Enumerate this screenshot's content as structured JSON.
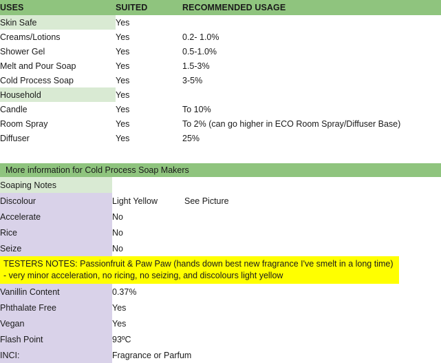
{
  "uses_table": {
    "headers": {
      "uses": "USES",
      "suited": "SUITED",
      "usage": "RECOMMENDED USAGE"
    },
    "sections": [
      {
        "title": "Skin Safe",
        "title_suited": "Yes",
        "rows": [
          {
            "label": "Creams/Lotions",
            "suited": "Yes",
            "usage": "0.2- 1.0%"
          },
          {
            "label": "Shower Gel",
            "suited": "Yes",
            "usage": "0.5-1.0%"
          },
          {
            "label": "Melt and Pour Soap",
            "suited": "Yes",
            "usage": "1.5-3%"
          },
          {
            "label": "Cold Process Soap",
            "suited": "Yes",
            "usage": "3-5%"
          }
        ]
      },
      {
        "title": "Household",
        "title_suited": "Yes",
        "rows": [
          {
            "label": "Candle",
            "suited": "Yes",
            "usage": "To 10%"
          },
          {
            "label": "Room Spray",
            "suited": "Yes",
            "usage": "To 2% (can go higher in ECO Room Spray/Diffuser Base)"
          },
          {
            "label": "Diffuser",
            "suited": "Yes",
            "usage": "25%"
          }
        ]
      }
    ]
  },
  "cp_section": {
    "banner": "More information for Cold Process Soap Makers",
    "notes_header": "Soaping Notes",
    "notes": [
      {
        "label": "Discolour",
        "value": "Light Yellow",
        "extra": "See Picture"
      },
      {
        "label": "Accelerate",
        "value": "No",
        "extra": ""
      },
      {
        "label": "Rice",
        "value": "No",
        "extra": ""
      },
      {
        "label": "Seize",
        "value": "No",
        "extra": ""
      }
    ],
    "testers_notes": "TESTERS NOTES: Passionfruit & Paw Paw (hands down best new fragrance I've smelt in a long time) - very minor acceleration, no ricing, no seizing, and discolours light yellow",
    "specs": [
      {
        "label": "Vanillin Content",
        "value": "0.37%"
      },
      {
        "label": "Phthalate Free",
        "value": "Yes"
      },
      {
        "label": "Vegan",
        "value": "Yes"
      },
      {
        "label": "Flash Point",
        "value": "93ºC"
      },
      {
        "label": "INCI:",
        "value": "Fragrance or Parfum"
      }
    ]
  },
  "colors": {
    "header_green": "#8fc47e",
    "light_green": "#d9ead3",
    "lavender": "#d9d2e9",
    "highlight_yellow": "#ffff00"
  }
}
